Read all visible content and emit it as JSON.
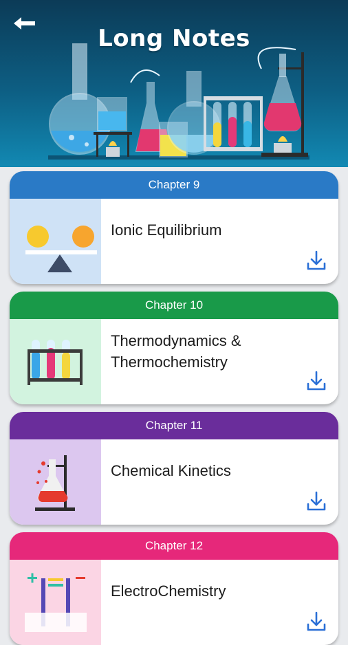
{
  "header": {
    "title": "Long Notes",
    "back_icon": "back-arrow-icon",
    "background": "#0d5f84"
  },
  "chapters": [
    {
      "chapter": "Chapter 9",
      "title": "Ionic Equilibrium",
      "color": "#2a7ac6",
      "thumb_bg": "#cfe2f6",
      "icon": "balance-scale-icon",
      "download_icon": "download-icon"
    },
    {
      "chapter": "Chapter 10",
      "title": "Thermodynamics & Thermochemistry",
      "color": "#199a49",
      "thumb_bg": "#d2f3df",
      "icon": "test-tube-rack-icon",
      "download_icon": "download-icon"
    },
    {
      "chapter": "Chapter 11",
      "title": "Chemical Kinetics",
      "color": "#6a2d9b",
      "thumb_bg": "#dcc7ef",
      "icon": "lab-flask-stand-icon",
      "download_icon": "download-icon"
    },
    {
      "chapter": "Chapter 12",
      "title": "ElectroChemistry",
      "color": "#e6287a",
      "thumb_bg": "#fbd5e4",
      "icon": "electrolysis-icon",
      "download_icon": "download-icon"
    }
  ]
}
